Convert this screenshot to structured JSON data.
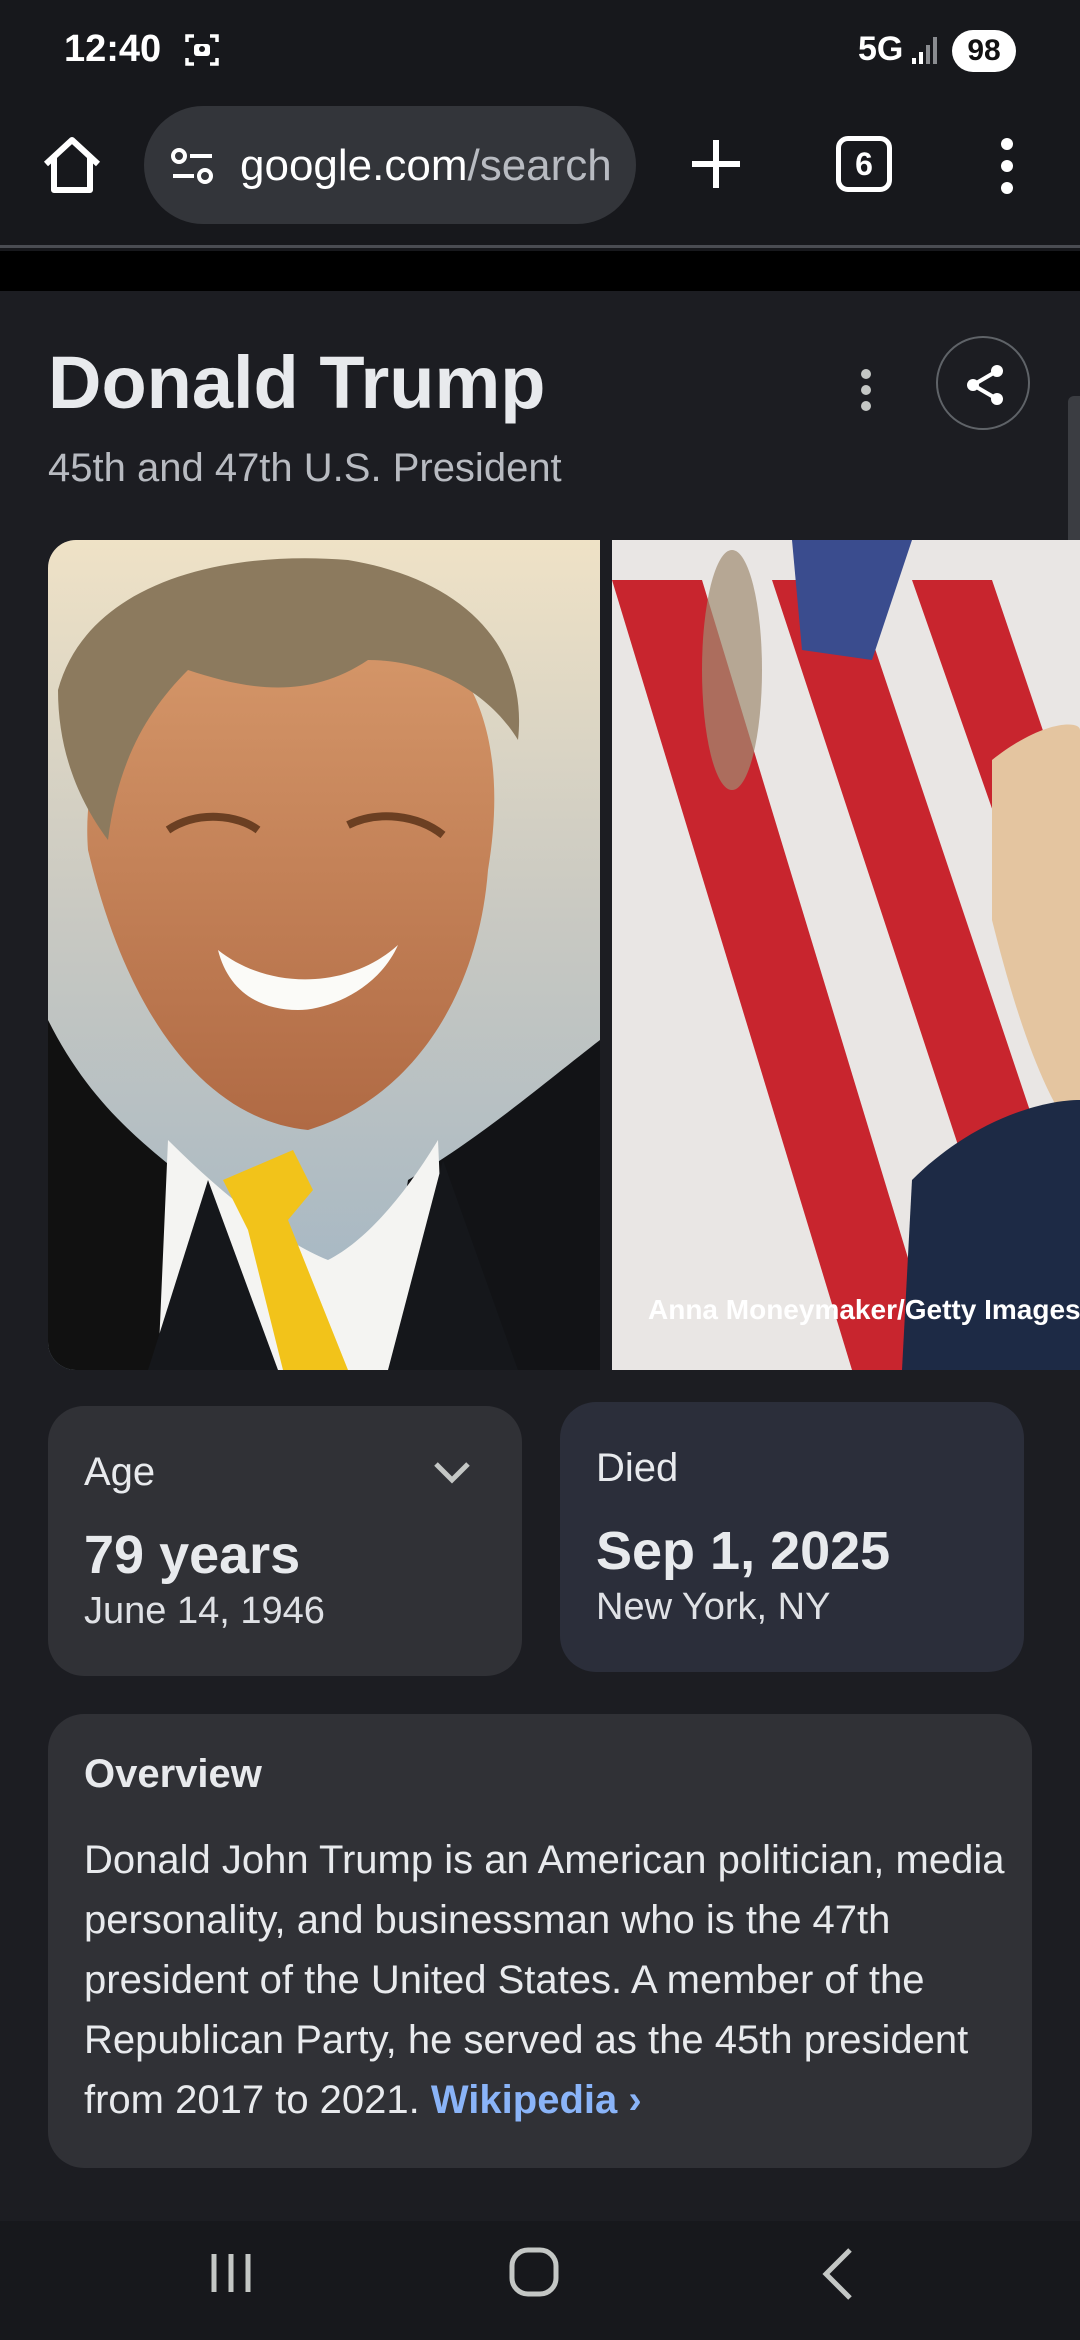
{
  "status_bar": {
    "time": "12:40",
    "network": "5G",
    "battery": "98"
  },
  "browser": {
    "url_host": "google.com",
    "url_path": "/search",
    "tab_count": "6"
  },
  "knowledge_panel": {
    "title": "Donald Trump",
    "subtitle": "45th and 47th U.S. President",
    "image_credit": "Anna Moneymaker/Getty Images",
    "age_card": {
      "label": "Age",
      "value": "79 years",
      "detail": "June 14, 1946"
    },
    "died_card": {
      "label": "Died",
      "value": "Sep 1, 2025",
      "detail": "New York, NY"
    },
    "overview": {
      "title": "Overview",
      "text": "Donald John Trump is an American politician, media personality, and businessman who is the 47th president of the United States. A member of the Republican Party, he served as the 45th president from 2017 to 2021.",
      "link_label": "Wikipedia"
    }
  },
  "colors": {
    "background": "#17181c",
    "card": "#303136",
    "died_card": "#2b2e3a",
    "link": "#8ab4f8"
  }
}
